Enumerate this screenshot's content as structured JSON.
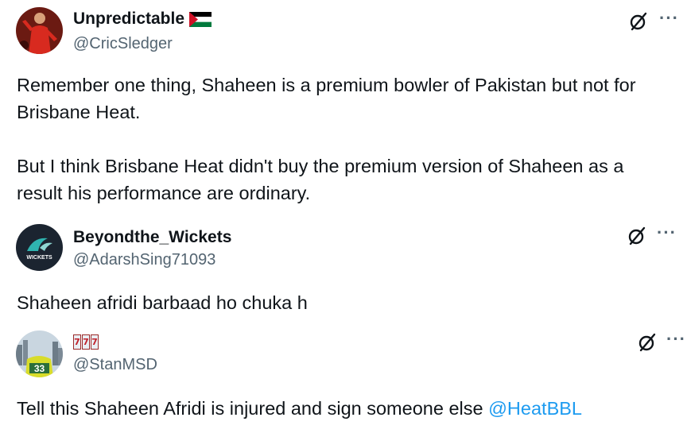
{
  "tweets": [
    {
      "display_name": "Unpredictable",
      "name_emoji": "palestine-flag",
      "handle": "@CricSledger",
      "paragraphs": [
        "Remember one thing, Shaheen is a premium bowler of Pakistan but not for Brisbane Heat.",
        "But I think Brisbane Heat didn't buy the premium version of Shaheen as a result his performance are ordinary."
      ]
    },
    {
      "display_name": "Beyondthe_Wickets",
      "handle": "@AdarshSing71093",
      "avatar_text": "WICKETS",
      "text": "Shaheen afridi barbaad ho chuka h"
    },
    {
      "display_name_emoji": [
        "7",
        "7",
        "7"
      ],
      "handle": "@StanMSD",
      "avatar_text": "33",
      "text_before": "Tell this Shaheen Afridi is injured and sign someone else ",
      "mention": "@HeatBBL"
    }
  ],
  "more_label": "···",
  "colors": {
    "text": "#0f1419",
    "secondary": "#536471",
    "link": "#1d9bf0"
  },
  "icons": [
    "grok-icon",
    "more-icon",
    "palestine-flag-icon",
    "slot-machine-icon"
  ]
}
